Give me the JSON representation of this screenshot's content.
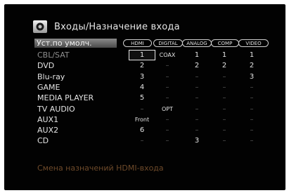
{
  "header": {
    "title": "Входы/Назначение входа",
    "icon": "input-assign-icon"
  },
  "default_button": "Уст.по умолч.",
  "columns": [
    "HDMI",
    "DIGITAL",
    "ANALOG",
    "COMP",
    "VIDEO"
  ],
  "rows": [
    {
      "label": "CBL/SAT",
      "cells": [
        "1",
        "COAX",
        "1",
        "1",
        "1"
      ]
    },
    {
      "label": "DVD",
      "cells": [
        "2",
        "–",
        "2",
        "2",
        "2"
      ]
    },
    {
      "label": "Blu-ray",
      "cells": [
        "3",
        "–",
        "–",
        "–",
        "3"
      ]
    },
    {
      "label": "GAME",
      "cells": [
        "4",
        "–",
        "–",
        "–",
        "–"
      ]
    },
    {
      "label": "MEDIA PLAYER",
      "cells": [
        "5",
        "–",
        "–",
        "–",
        "–"
      ]
    },
    {
      "label": "TV AUDIO",
      "cells": [
        "–",
        "OPT",
        "–",
        "–",
        "–"
      ]
    },
    {
      "label": "AUX1",
      "cells": [
        "Front",
        "–",
        "–",
        "–",
        "–"
      ]
    },
    {
      "label": "AUX2",
      "cells": [
        "6",
        "–",
        "–",
        "–",
        "–"
      ]
    },
    {
      "label": "CD",
      "cells": [
        "–",
        "–",
        "3",
        "–",
        "–"
      ]
    }
  ],
  "footer": "Смена назначений HDMI-входа",
  "colors": {
    "background": "#020202",
    "text": "#e4e4e4",
    "footer": "#6e4a2a"
  }
}
